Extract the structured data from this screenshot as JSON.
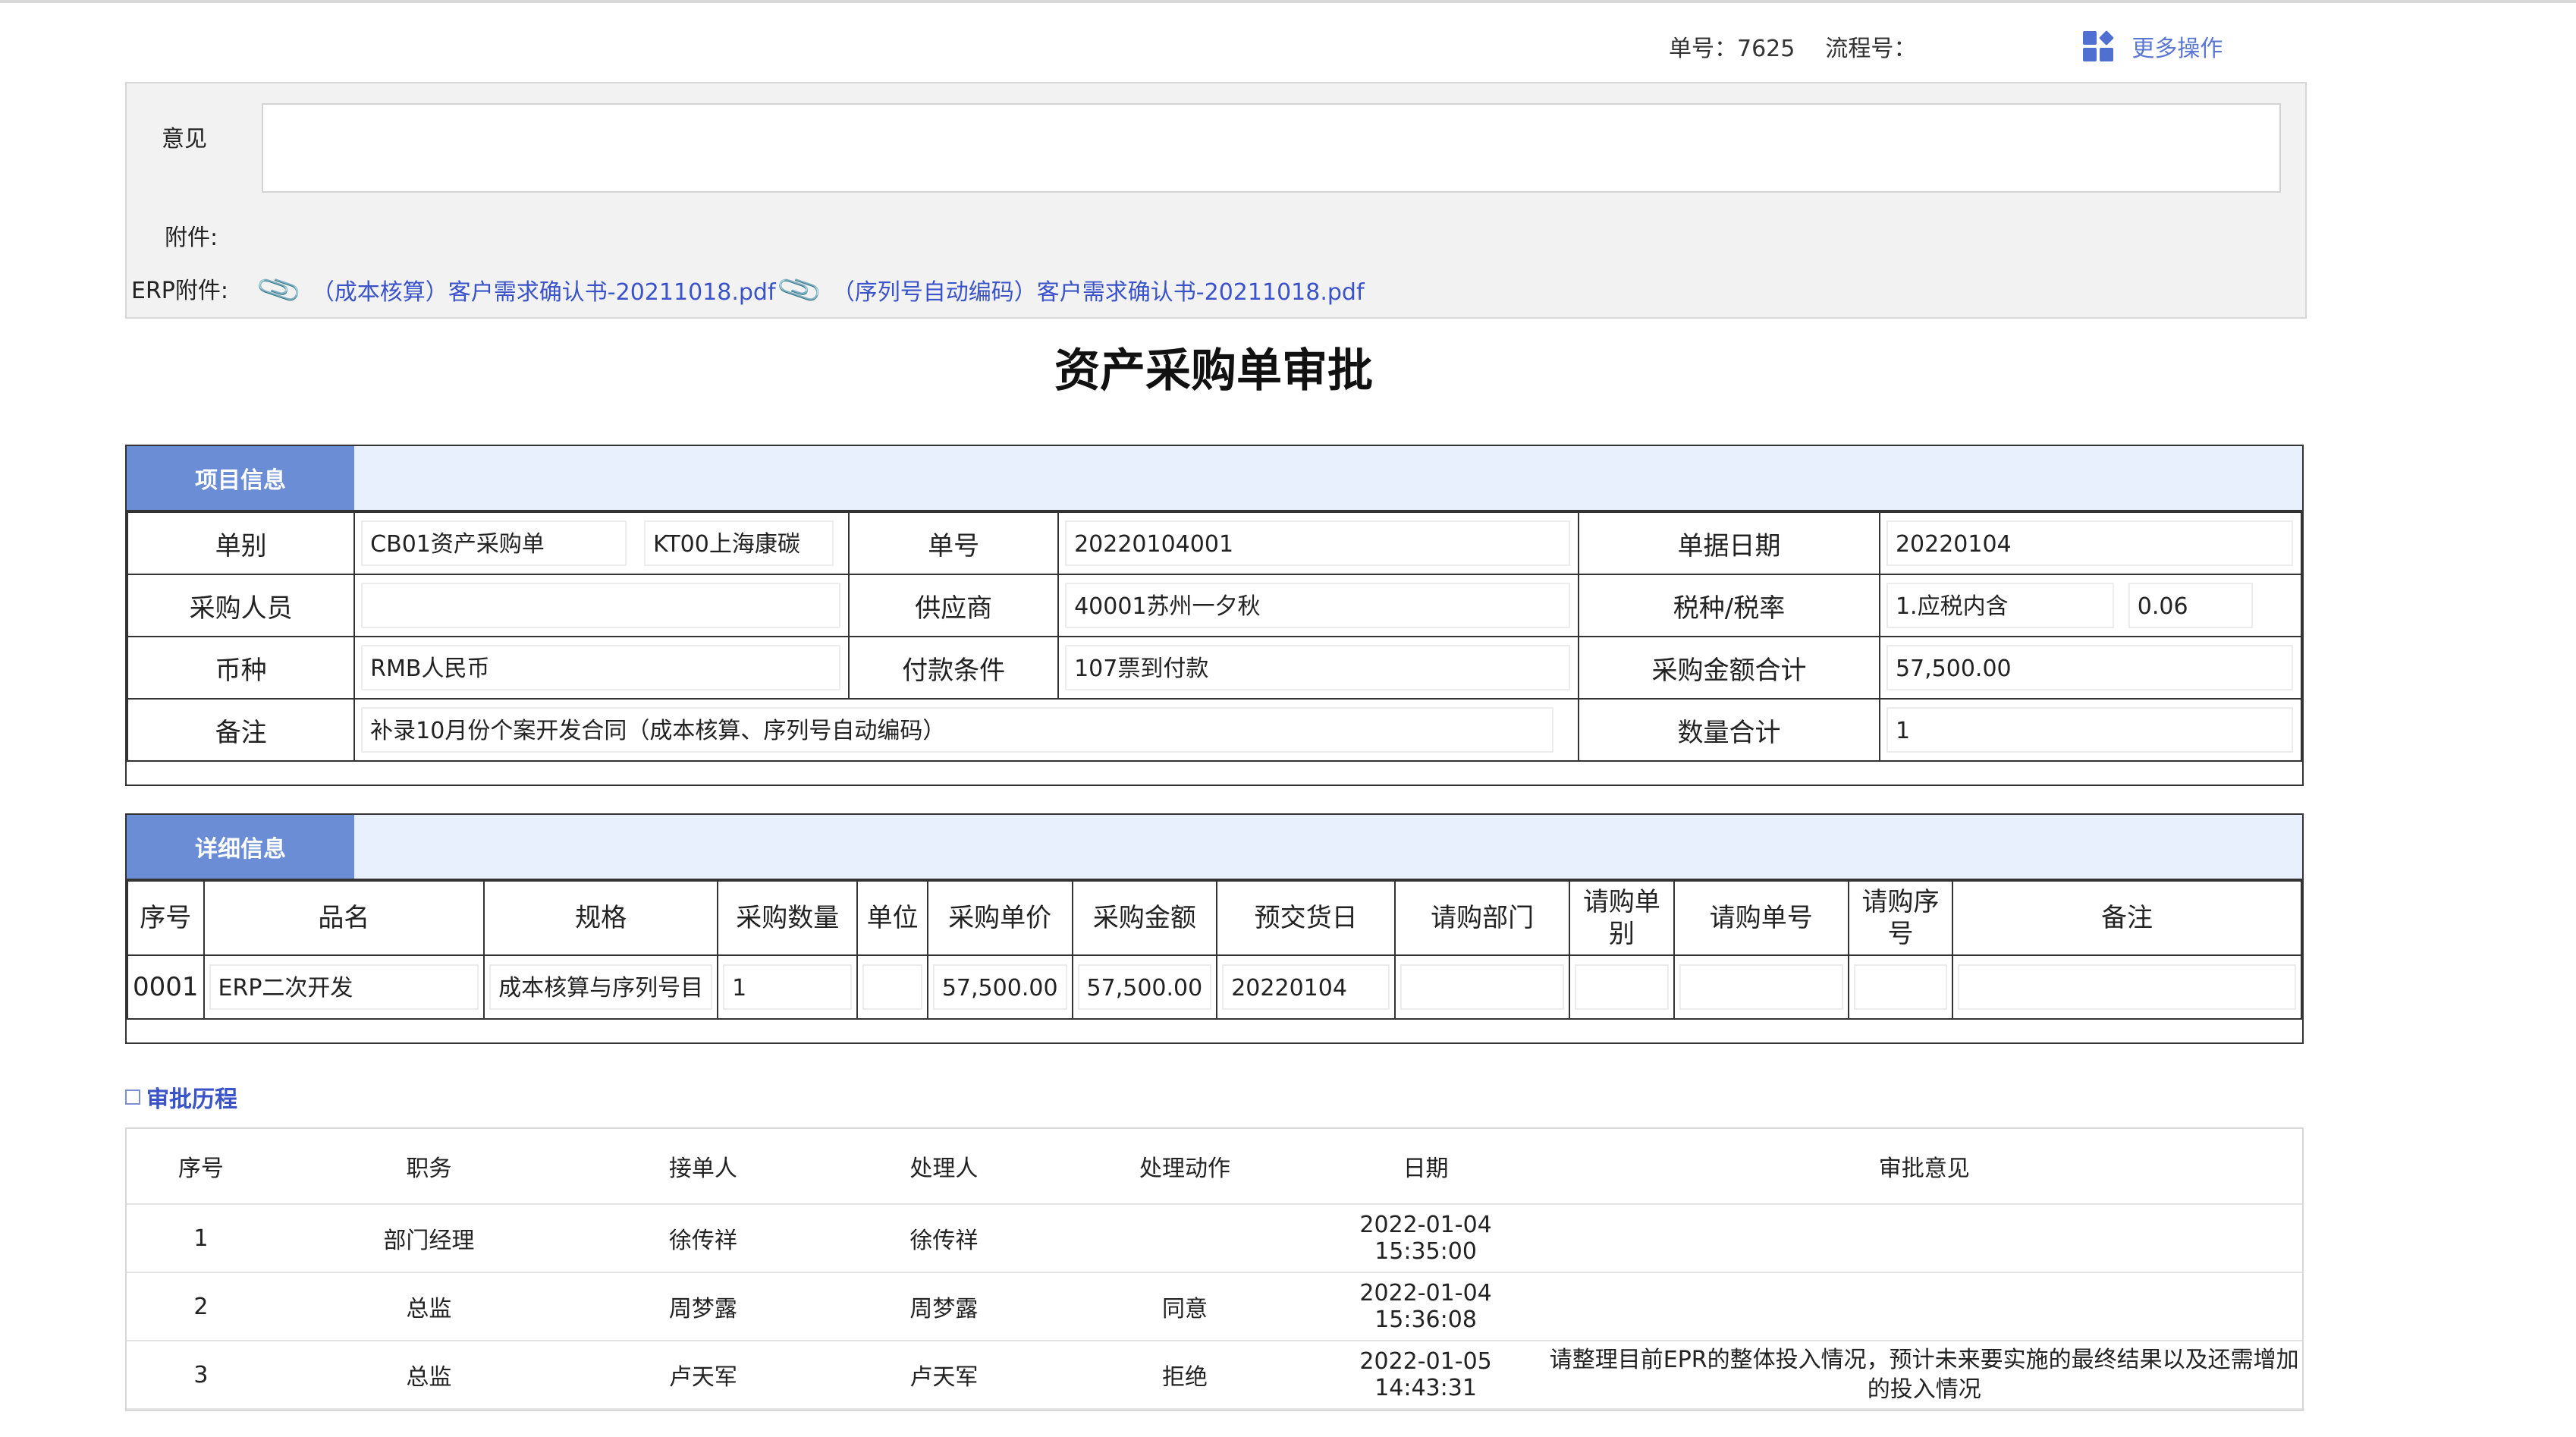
{
  "topbar": {
    "order_no": "单号：7625",
    "flow_no": "流程号：",
    "more_actions": "更多操作"
  },
  "opinion": {
    "label": "意见",
    "value": "",
    "attachment_label": "附件:",
    "erp_attachment_label": "ERP附件:",
    "erp_attachments": [
      "（成本核算）客户需求确认书-20211018.pdf",
      "（序列号自动编码）客户需求确认书-20211018.pdf"
    ]
  },
  "page_title": "资产采购单审批",
  "project_info": {
    "tab": "项目信息",
    "fields": {
      "type_label": "单别",
      "type_value": "CB01资产采购单",
      "type_value2": "KT00上海康碳",
      "no_label": "单号",
      "no_value": "20220104001",
      "date_label": "单据日期",
      "date_value": "20220104",
      "buyer_label": "采购人员",
      "buyer_value": "",
      "supplier_label": "供应商",
      "supplier_value": "40001苏州一夕秋",
      "tax_label": "税种/税率",
      "tax_value": "1.应税内含",
      "tax_rate": "0.06",
      "currency_label": "币种",
      "currency_value": "RMB人民币",
      "payment_label": "付款条件",
      "payment_value": "107票到付款",
      "total_amount_label": "采购金额合计",
      "total_amount_value": "57,500.00",
      "remark_label": "备注",
      "remark_value": "补录10月份个案开发合同（成本核算、序列号自动编码）",
      "total_qty_label": "数量合计",
      "total_qty_value": "1"
    }
  },
  "detail_info": {
    "tab": "详细信息",
    "columns": [
      "序号",
      "品名",
      "规格",
      "采购数量",
      "单位",
      "采购单价",
      "采购金额",
      "预交货日",
      "请购部门",
      "请购单别",
      "请购单号",
      "请购序号",
      "备注"
    ],
    "rows": [
      [
        "0001",
        "ERP二次开发",
        "成本核算与序列号目",
        "1",
        "",
        "57,500.00",
        "57,500.00",
        "20220104",
        "",
        "",
        "",
        "",
        ""
      ]
    ]
  },
  "history": {
    "title": "审批历程",
    "columns": [
      "序号",
      "职务",
      "接单人",
      "处理人",
      "处理动作",
      "日期",
      "审批意见"
    ],
    "rows": [
      [
        "1",
        "部门经理",
        "徐传祥",
        "徐传祥",
        "",
        "2022-01-04 15:35:00",
        ""
      ],
      [
        "2",
        "总监",
        "周梦露",
        "周梦露",
        "同意",
        "2022-01-04 15:36:08",
        ""
      ],
      [
        "3",
        "总监",
        "卢天军",
        "卢天军",
        "拒绝",
        "2022-01-05 14:43:31",
        "请整理目前EPR的整体投入情况，预计未来要实施的最终结果以及还需增加的投入情况"
      ]
    ]
  }
}
